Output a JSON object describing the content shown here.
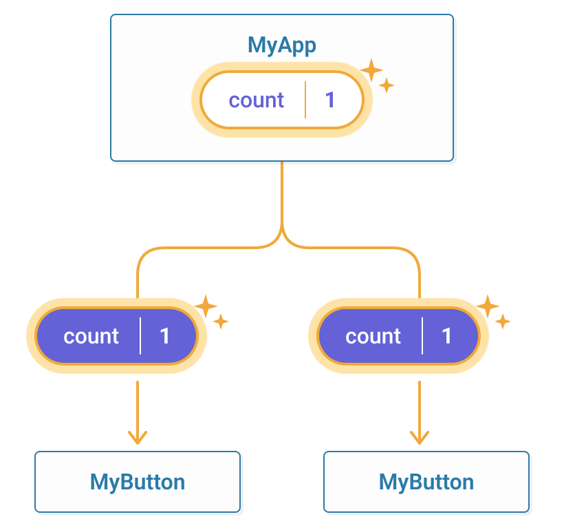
{
  "parent": {
    "title": "MyApp",
    "state": {
      "label": "count",
      "value": "1"
    }
  },
  "props": [
    {
      "label": "count",
      "value": "1"
    },
    {
      "label": "count",
      "value": "1"
    }
  ],
  "children": [
    {
      "title": "MyButton"
    },
    {
      "title": "MyButton"
    }
  ],
  "colors": {
    "box_border": "#2a7ba8",
    "pill_border": "#f0a93a",
    "pill_glow": "#fde3a7",
    "light_text": "#6462d6",
    "dark_fill": "#6462d6",
    "dark_text": "#ffffff"
  }
}
